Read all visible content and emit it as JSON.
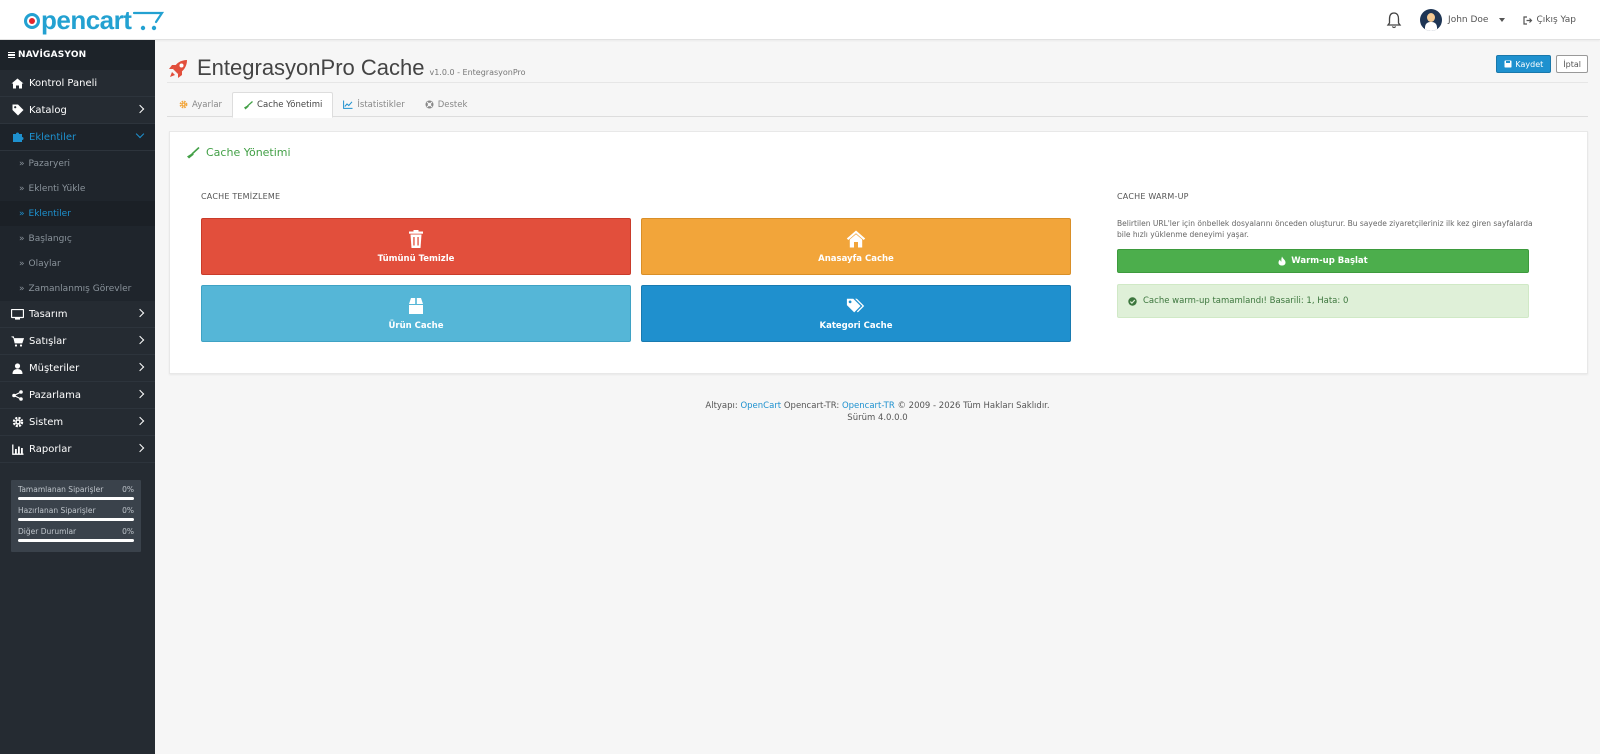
{
  "header": {
    "logo_text": "pencart",
    "user_name": "John Doe",
    "logout_label": "Çıkış Yap"
  },
  "sidebar": {
    "heading": "NAVİGASYON",
    "items": [
      {
        "label": "Kontrol Paneli",
        "icon": "home-icon"
      },
      {
        "label": "Katalog",
        "icon": "tag-icon"
      },
      {
        "label": "Eklentiler",
        "icon": "puzzle-icon"
      },
      {
        "label": "Tasarım",
        "icon": "monitor-icon"
      },
      {
        "label": "Satışlar",
        "icon": "cart-icon"
      },
      {
        "label": "Müşteriler",
        "icon": "user-icon"
      },
      {
        "label": "Pazarlama",
        "icon": "share-icon"
      },
      {
        "label": "Sistem",
        "icon": "gear-icon"
      },
      {
        "label": "Raporlar",
        "icon": "bar-chart-icon"
      }
    ],
    "sub_items": [
      {
        "label": "Pazaryeri"
      },
      {
        "label": "Eklenti Yükle"
      },
      {
        "label": "Eklentiler"
      },
      {
        "label": "Başlangıç"
      },
      {
        "label": "Olaylar"
      },
      {
        "label": "Zamanlanmış Görevler"
      }
    ],
    "stats": [
      {
        "label": "Tamamlanan Siparişler",
        "value": "0%"
      },
      {
        "label": "Hazırlanan Siparişler",
        "value": "0%"
      },
      {
        "label": "Diğer Durumlar",
        "value": "0%"
      }
    ]
  },
  "page": {
    "title": "EntegrasyonPro Cache",
    "version": "v1.0.0 - EntegrasyonPro",
    "save_label": "Kaydet",
    "cancel_label": "İptal"
  },
  "tabs": [
    {
      "label": "Ayarlar"
    },
    {
      "label": "Cache Yönetimi"
    },
    {
      "label": "İstatistikler"
    },
    {
      "label": "Destek"
    }
  ],
  "panel": {
    "heading": "Cache Yönetimi",
    "clear_section": "CACHE TEMİZLEME",
    "buttons": {
      "clear_all": "Tümünü Temizle",
      "home_cache": "Anasayfa Cache",
      "product_cache": "Ürün Cache",
      "category_cache": "Kategori Cache"
    },
    "warmup_section": "CACHE WARM-UP",
    "warmup_desc": "Belirtilen URL'ler için önbellek dosyalarını önceden oluşturur. Bu sayede ziyaretçileriniz ilk kez giren sayfalarda bile hızlı yüklenme deneyimi yaşar.",
    "warmup_button": "Warm-up Başlat",
    "alert": "Cache warm-up tamamlandı! Basarili: 1, Hata: 0"
  },
  "footer": {
    "prefix": "Altyapı:",
    "link1": "OpenCart",
    "middle": "Opencart-TR:",
    "link2": "Opencart-TR",
    "suffix": "© 2009 - 2026 Tüm Hakları Saklıdır.",
    "version": "Sürüm 4.0.0.0"
  },
  "colors": {
    "brand": "#23a1d1",
    "primary": "#1e91cf",
    "success": "#4cae4c",
    "danger": "#e24f3c",
    "warning": "#f2a53a",
    "info": "#55b6d7",
    "sidebar": "#252b32"
  }
}
